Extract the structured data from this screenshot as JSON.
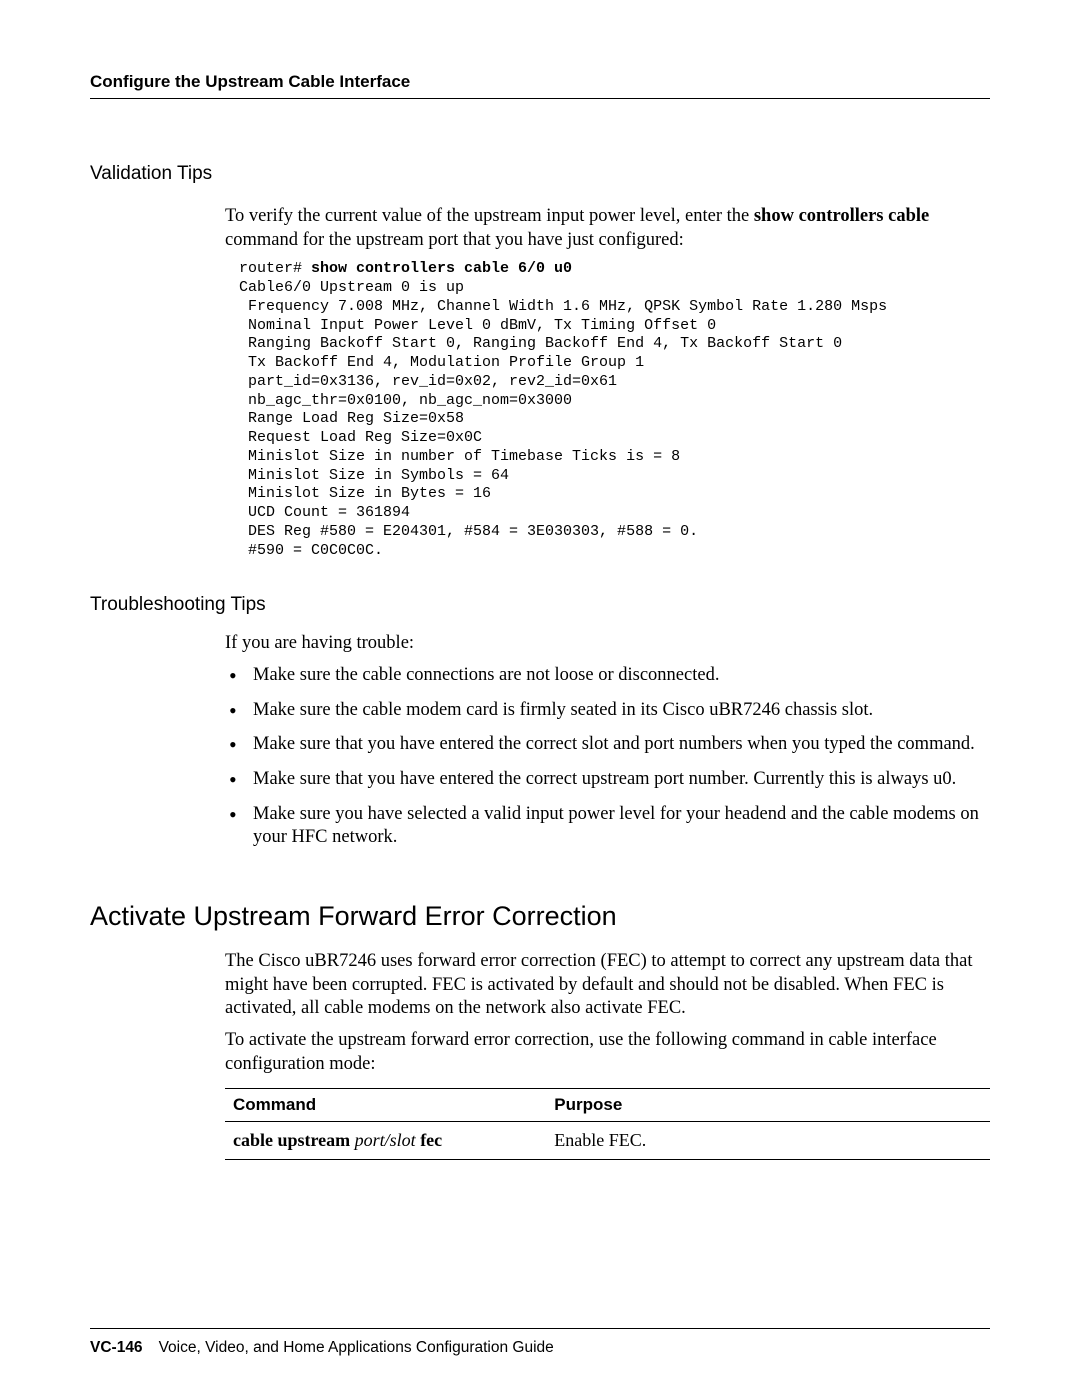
{
  "header": {
    "running_title": "Configure the Upstream Cable Interface"
  },
  "sections": {
    "validation": {
      "title": "Validation Tips",
      "intro_prefix": "To verify the current value of the upstream input power level, enter the ",
      "intro_cmd": "show controllers cable",
      "intro_suffix": " command for the upstream port that you have just configured:",
      "code_prompt": "router# ",
      "code_cmd": "show controllers cable 6/0 u0",
      "code_lines": [
        "Cable6/0 Upstream 0 is up",
        " Frequency 7.008 MHz, Channel Width 1.6 MHz, QPSK Symbol Rate 1.280 Msps",
        " Nominal Input Power Level 0 dBmV, Tx Timing Offset 0",
        " Ranging Backoff Start 0, Ranging Backoff End 4, Tx Backoff Start 0",
        " Tx Backoff End 4, Modulation Profile Group 1",
        " part_id=0x3136, rev_id=0x02, rev2_id=0x61",
        " nb_agc_thr=0x0100, nb_agc_nom=0x3000",
        " Range Load Reg Size=0x58",
        " Request Load Reg Size=0x0C",
        " Minislot Size in number of Timebase Ticks is = 8",
        " Minislot Size in Symbols = 64",
        " Minislot Size in Bytes = 16",
        " UCD Count = 361894",
        " DES Reg #580 = E204301, #584 = 3E030303, #588 = 0.",
        " #590 = C0C0C0C."
      ]
    },
    "troubleshooting": {
      "title": "Troubleshooting Tips",
      "intro": "If you are having trouble:",
      "bullets": [
        "Make sure the cable connections are not loose or disconnected.",
        "Make sure the cable modem card is firmly seated in its Cisco uBR7246 chassis slot.",
        "Make sure that you have entered the correct slot and port numbers when you typed the command.",
        "Make sure that you have entered the correct upstream port number. Currently this is always u0.",
        "Make sure you have selected a valid input power level for your headend and the cable modems on your HFC network."
      ]
    },
    "fec": {
      "title": "Activate Upstream Forward Error Correction",
      "para1": "The Cisco uBR7246 uses forward error correction (FEC) to attempt to correct any upstream data that might have been corrupted. FEC is activated by default and should not be disabled. When FEC is activated, all cable modems on the network also activate FEC.",
      "para2": "To activate the upstream forward error correction, use the following command in cable interface configuration mode:",
      "table": {
        "headers": {
          "command": "Command",
          "purpose": "Purpose"
        },
        "row": {
          "cmd_prefix": "cable upstream ",
          "cmd_italic": "port/slot",
          "cmd_suffix": " fec",
          "purpose": "Enable FEC."
        }
      }
    }
  },
  "footer": {
    "page_number": "VC-146",
    "book_title": "Voice, Video, and Home Applications Configuration Guide"
  }
}
